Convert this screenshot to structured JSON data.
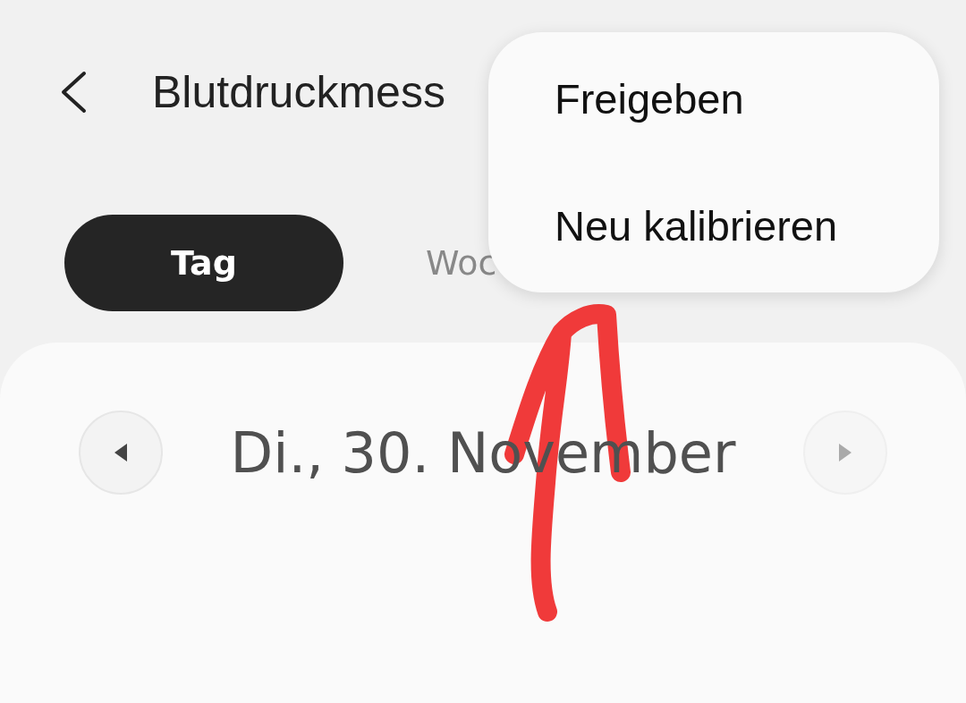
{
  "header": {
    "title": "Blutdruckmess"
  },
  "tabs": [
    {
      "label": "Tag",
      "selected": true
    },
    {
      "label": "Woc",
      "selected": false
    }
  ],
  "date_nav": {
    "label": "Di., 30. November",
    "prev_disabled": false,
    "next_disabled": true
  },
  "menu": {
    "items": [
      {
        "label": "Freigeben"
      },
      {
        "label": "Neu kalibrieren"
      }
    ]
  }
}
